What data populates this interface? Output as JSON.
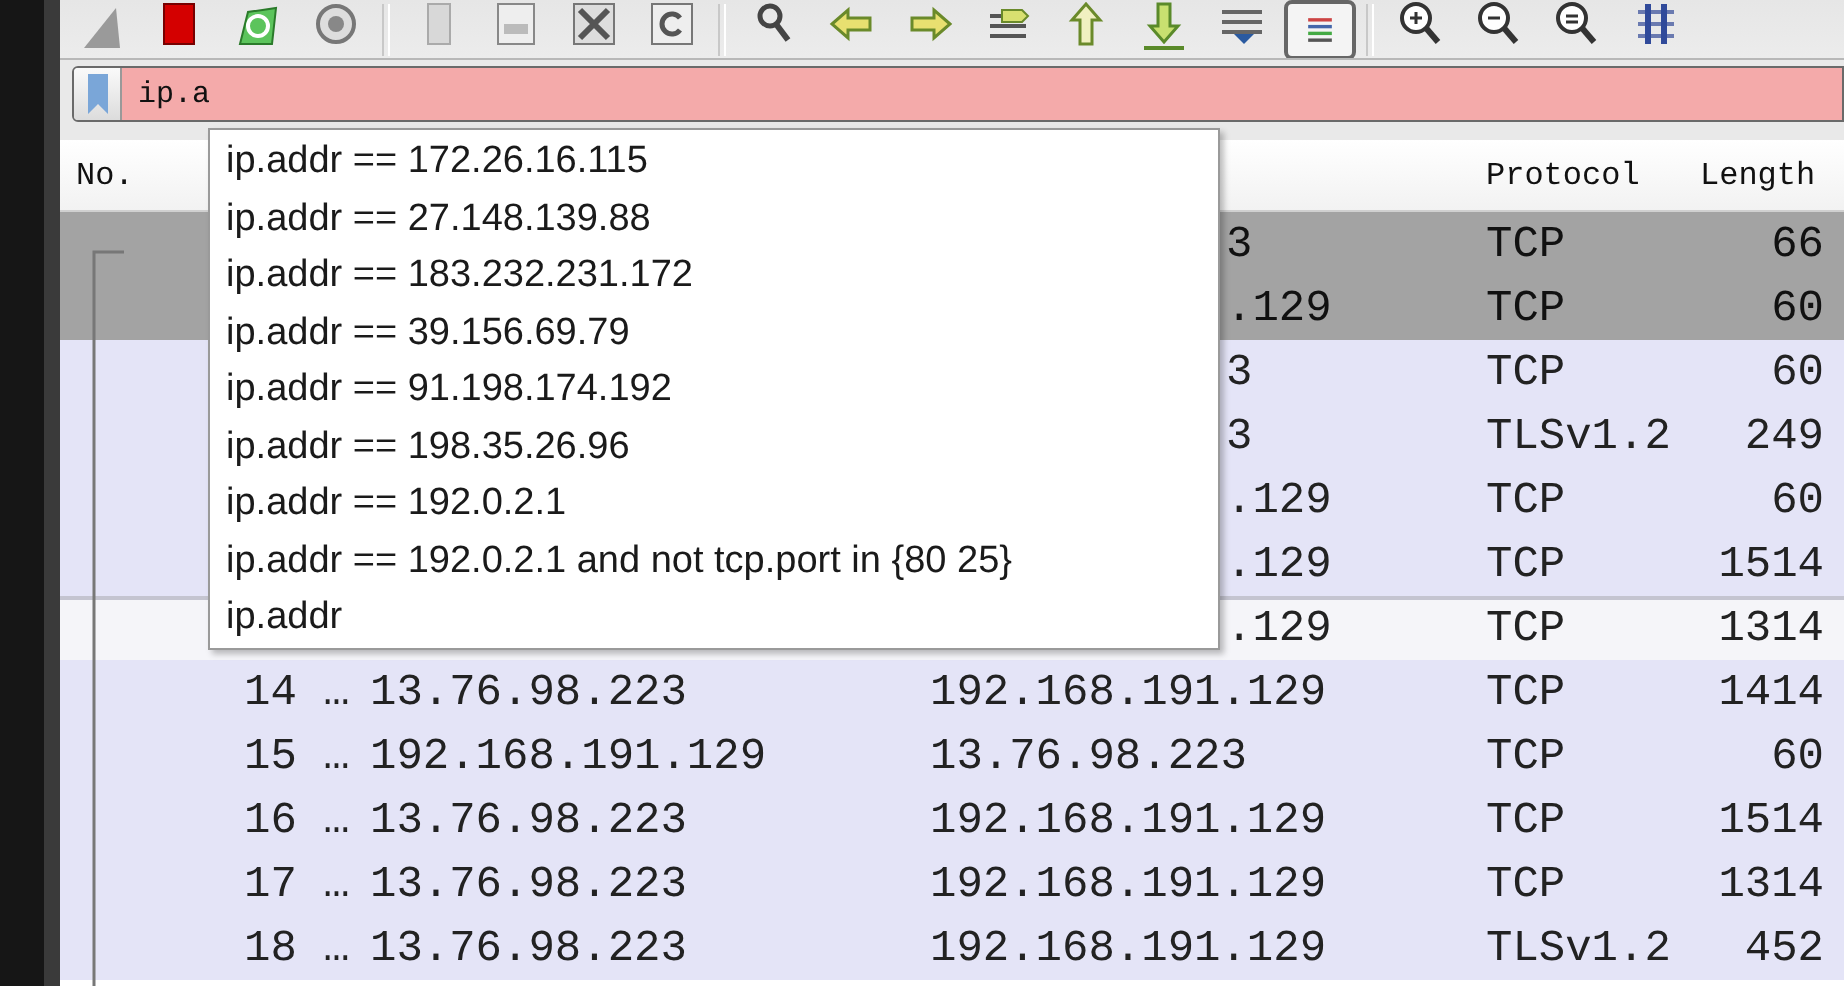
{
  "toolbar": [
    {
      "kind": "fin",
      "pressed": false
    },
    {
      "kind": "stop",
      "pressed": false
    },
    {
      "kind": "restart",
      "pressed": false
    },
    {
      "kind": "gear",
      "pressed": false
    },
    {
      "kind": "separator"
    },
    {
      "kind": "document",
      "pressed": false
    },
    {
      "kind": "binary",
      "pressed": false
    },
    {
      "kind": "close",
      "pressed": false
    },
    {
      "kind": "reload",
      "pressed": false
    },
    {
      "kind": "separator"
    },
    {
      "kind": "search",
      "pressed": false
    },
    {
      "kind": "left",
      "pressed": false
    },
    {
      "kind": "right",
      "pressed": false
    },
    {
      "kind": "goto",
      "pressed": false
    },
    {
      "kind": "up",
      "pressed": false
    },
    {
      "kind": "down",
      "pressed": false
    },
    {
      "kind": "bottom",
      "pressed": false
    },
    {
      "kind": "lines",
      "pressed": true
    },
    {
      "kind": "separator"
    },
    {
      "kind": "zoomin",
      "pressed": false
    },
    {
      "kind": "zoomout",
      "pressed": false
    },
    {
      "kind": "zoomreset",
      "pressed": false
    },
    {
      "kind": "columns",
      "pressed": false
    }
  ],
  "filter": {
    "value": "ip.a"
  },
  "columns": {
    "no": "No.",
    "protocol": "Protocol",
    "length": "Length"
  },
  "packets": [
    {
      "destination": "3",
      "protocol": "TCP",
      "length": "66",
      "selected": true,
      "highlighted": false
    },
    {
      "destination": ".129",
      "protocol": "TCP",
      "length": "60",
      "selected": true,
      "highlighted": false
    },
    {
      "destination": "3",
      "protocol": "TCP",
      "length": "60",
      "selected": false,
      "highlighted": false
    },
    {
      "destination": "3",
      "protocol": "TLSv1.2",
      "length": "249",
      "selected": false,
      "highlighted": false
    },
    {
      "destination": ".129",
      "protocol": "TCP",
      "length": "60",
      "selected": false,
      "highlighted": false
    },
    {
      "destination": ".129",
      "protocol": "TCP",
      "length": "1514",
      "selected": false,
      "highlighted": false
    },
    {
      "destination": ".129",
      "protocol": "TCP",
      "length": "1314",
      "selected": false,
      "highlighted": true
    },
    {
      "no": "14 …",
      "source": "13.76.98.223",
      "destination": "192.168.191.129",
      "protocol": "TCP",
      "length": "1414",
      "selected": false,
      "highlighted": false
    },
    {
      "no": "15 …",
      "source": "192.168.191.129",
      "destination": "13.76.98.223",
      "protocol": "TCP",
      "length": "60",
      "selected": false,
      "highlighted": false
    },
    {
      "no": "16 …",
      "source": "13.76.98.223",
      "destination": "192.168.191.129",
      "protocol": "TCP",
      "length": "1514",
      "selected": false,
      "highlighted": false
    },
    {
      "no": "17 …",
      "source": "13.76.98.223",
      "destination": "192.168.191.129",
      "protocol": "TCP",
      "length": "1314",
      "selected": false,
      "highlighted": false
    },
    {
      "no": "18 …",
      "source": "13.76.98.223",
      "destination": "192.168.191.129",
      "protocol": "TLSv1.2",
      "length": "452",
      "selected": false,
      "highlighted": false
    }
  ],
  "suggestions": [
    "ip.addr == 172.26.16.115",
    "ip.addr == 27.148.139.88",
    "ip.addr == 183.232.231.172",
    "ip.addr == 39.156.69.79",
    "ip.addr == 91.198.174.192",
    "ip.addr == 198.35.26.96",
    "ip.addr == 192.0.2.1",
    "ip.addr == 192.0.2.1 and not tcp.port in {80 25}",
    "ip.addr"
  ]
}
